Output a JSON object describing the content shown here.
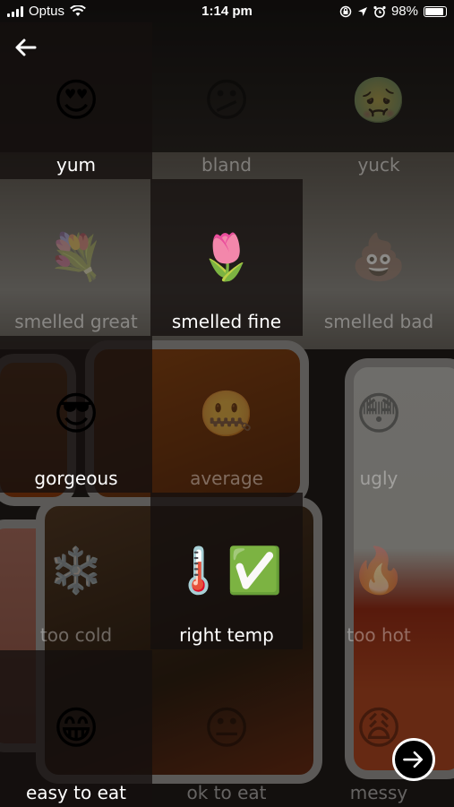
{
  "status_bar": {
    "carrier": "Optus",
    "time": "1:14 pm",
    "battery": "98%"
  },
  "rows": [
    {
      "cells": [
        {
          "emoji": "😍",
          "label": "yum",
          "selected": true
        },
        {
          "emoji": "😕",
          "label": "bland",
          "selected": false
        },
        {
          "emoji": "🤢",
          "label": "yuck",
          "selected": false
        }
      ]
    },
    {
      "cells": [
        {
          "emoji": "💐",
          "label": "smelled great",
          "selected": false
        },
        {
          "emoji": "🌷",
          "label": "smelled fine",
          "selected": true
        },
        {
          "emoji": "💩",
          "label": "smelled bad",
          "selected": false
        }
      ]
    },
    {
      "cells": [
        {
          "emoji": "😎",
          "label": "gorgeous",
          "selected": true
        },
        {
          "emoji": "🤐",
          "label": "average",
          "selected": false
        },
        {
          "emoji": "😳",
          "label": "ugly",
          "selected": false
        }
      ]
    },
    {
      "cells": [
        {
          "emoji": "❄️",
          "label": "too cold",
          "selected": false
        },
        {
          "emoji": "🌡️✅",
          "label": "right temp",
          "selected": true
        },
        {
          "emoji": "🔥",
          "label": "too hot",
          "selected": false
        }
      ]
    },
    {
      "cells": [
        {
          "emoji": "😁",
          "label": "easy to eat",
          "selected": true
        },
        {
          "emoji": "😐",
          "label": "ok to eat",
          "selected": false
        },
        {
          "emoji": "😩",
          "label": "messy",
          "selected": false
        }
      ]
    }
  ]
}
